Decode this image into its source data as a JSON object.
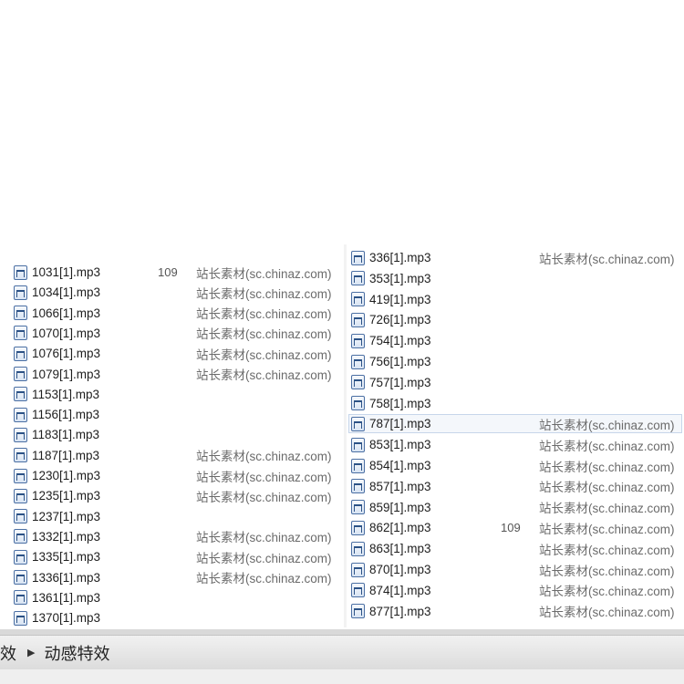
{
  "left_pane": {
    "rows": [
      {
        "name": "1031[1].mp3",
        "num": "109",
        "desc": "站长素材(sc.chinaz.com)"
      },
      {
        "name": "1034[1].mp3",
        "num": "",
        "desc": "站长素材(sc.chinaz.com)"
      },
      {
        "name": "1066[1].mp3",
        "num": "",
        "desc": "站长素材(sc.chinaz.com)"
      },
      {
        "name": "1070[1].mp3",
        "num": "",
        "desc": "站长素材(sc.chinaz.com)"
      },
      {
        "name": "1076[1].mp3",
        "num": "",
        "desc": "站长素材(sc.chinaz.com)"
      },
      {
        "name": "1079[1].mp3",
        "num": "",
        "desc": "站长素材(sc.chinaz.com)"
      },
      {
        "name": "1153[1].mp3",
        "num": "",
        "desc": ""
      },
      {
        "name": "1156[1].mp3",
        "num": "",
        "desc": ""
      },
      {
        "name": "1183[1].mp3",
        "num": "",
        "desc": ""
      },
      {
        "name": "1187[1].mp3",
        "num": "",
        "desc": "站长素材(sc.chinaz.com)"
      },
      {
        "name": "1230[1].mp3",
        "num": "",
        "desc": "站长素材(sc.chinaz.com)"
      },
      {
        "name": "1235[1].mp3",
        "num": "",
        "desc": "站长素材(sc.chinaz.com)"
      },
      {
        "name": "1237[1].mp3",
        "num": "",
        "desc": ""
      },
      {
        "name": "1332[1].mp3",
        "num": "",
        "desc": "站长素材(sc.chinaz.com)"
      },
      {
        "name": "1335[1].mp3",
        "num": "",
        "desc": "站长素材(sc.chinaz.com)"
      },
      {
        "name": "1336[1].mp3",
        "num": "",
        "desc": "站长素材(sc.chinaz.com)"
      },
      {
        "name": "1361[1].mp3",
        "num": "",
        "desc": ""
      },
      {
        "name": "1370[1].mp3",
        "num": "",
        "desc": ""
      }
    ]
  },
  "right_pane": {
    "rows": [
      {
        "name": "336[1].mp3",
        "num": "",
        "desc": "站长素材(sc.chinaz.com)",
        "selected": false
      },
      {
        "name": "353[1].mp3",
        "num": "",
        "desc": "",
        "selected": false
      },
      {
        "name": "419[1].mp3",
        "num": "",
        "desc": "",
        "selected": false
      },
      {
        "name": "726[1].mp3",
        "num": "",
        "desc": "",
        "selected": false
      },
      {
        "name": "754[1].mp3",
        "num": "",
        "desc": "",
        "selected": false
      },
      {
        "name": "756[1].mp3",
        "num": "",
        "desc": "",
        "selected": false
      },
      {
        "name": "757[1].mp3",
        "num": "",
        "desc": "",
        "selected": false
      },
      {
        "name": "758[1].mp3",
        "num": "",
        "desc": "",
        "selected": false
      },
      {
        "name": "787[1].mp3",
        "num": "",
        "desc": "站长素材(sc.chinaz.com)",
        "selected": true
      },
      {
        "name": "853[1].mp3",
        "num": "",
        "desc": "站长素材(sc.chinaz.com)",
        "selected": false
      },
      {
        "name": "854[1].mp3",
        "num": "",
        "desc": "站长素材(sc.chinaz.com)",
        "selected": false
      },
      {
        "name": "857[1].mp3",
        "num": "",
        "desc": "站长素材(sc.chinaz.com)",
        "selected": false
      },
      {
        "name": "859[1].mp3",
        "num": "",
        "desc": "站长素材(sc.chinaz.com)",
        "selected": false
      },
      {
        "name": "862[1].mp3",
        "num": "109",
        "desc": "站长素材(sc.chinaz.com)",
        "selected": false
      },
      {
        "name": "863[1].mp3",
        "num": "",
        "desc": "站长素材(sc.chinaz.com)",
        "selected": false
      },
      {
        "name": "870[1].mp3",
        "num": "",
        "desc": "站长素材(sc.chinaz.com)",
        "selected": false
      },
      {
        "name": "874[1].mp3",
        "num": "",
        "desc": "站长素材(sc.chinaz.com)",
        "selected": false
      },
      {
        "name": "877[1].mp3",
        "num": "",
        "desc": "站长素材(sc.chinaz.com)",
        "selected": false
      }
    ]
  },
  "breadcrumb": {
    "parent": "效",
    "current": "动感特效"
  },
  "icons": {
    "file": "audio-file-icon",
    "separator": "triangle-right-icon"
  },
  "colors": {
    "selection_bg": "#f4f7fb",
    "selection_border": "#c7d6ea"
  }
}
